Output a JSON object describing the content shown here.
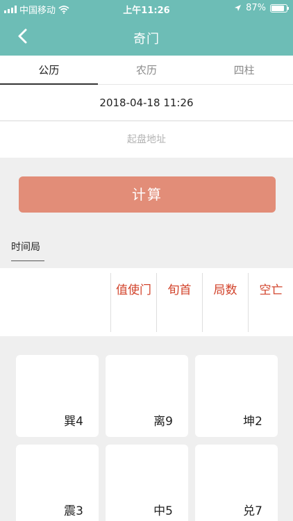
{
  "status": {
    "carrier": "中国移动",
    "time": "上午11:26",
    "battery": "87%",
    "battery_level": 0.87
  },
  "header": {
    "title": "奇门"
  },
  "tabs": [
    {
      "label": "公历",
      "active": true
    },
    {
      "label": "农历",
      "active": false
    },
    {
      "label": "四柱",
      "active": false
    }
  ],
  "datetime": "2018-04-18 11:26",
  "address": {
    "placeholder": "起盘地址",
    "value": ""
  },
  "calculate_label": "计算",
  "section": {
    "label": "时间局"
  },
  "info_columns": [
    "值使门",
    "旬首",
    "局数",
    "空亡"
  ],
  "palaces": [
    "巽4",
    "离9",
    "坤2",
    "震3",
    "中5",
    "兑7"
  ],
  "colors": {
    "primary": "#6dbdb6",
    "button": "#e28d78",
    "accent_text": "#d2432b"
  }
}
